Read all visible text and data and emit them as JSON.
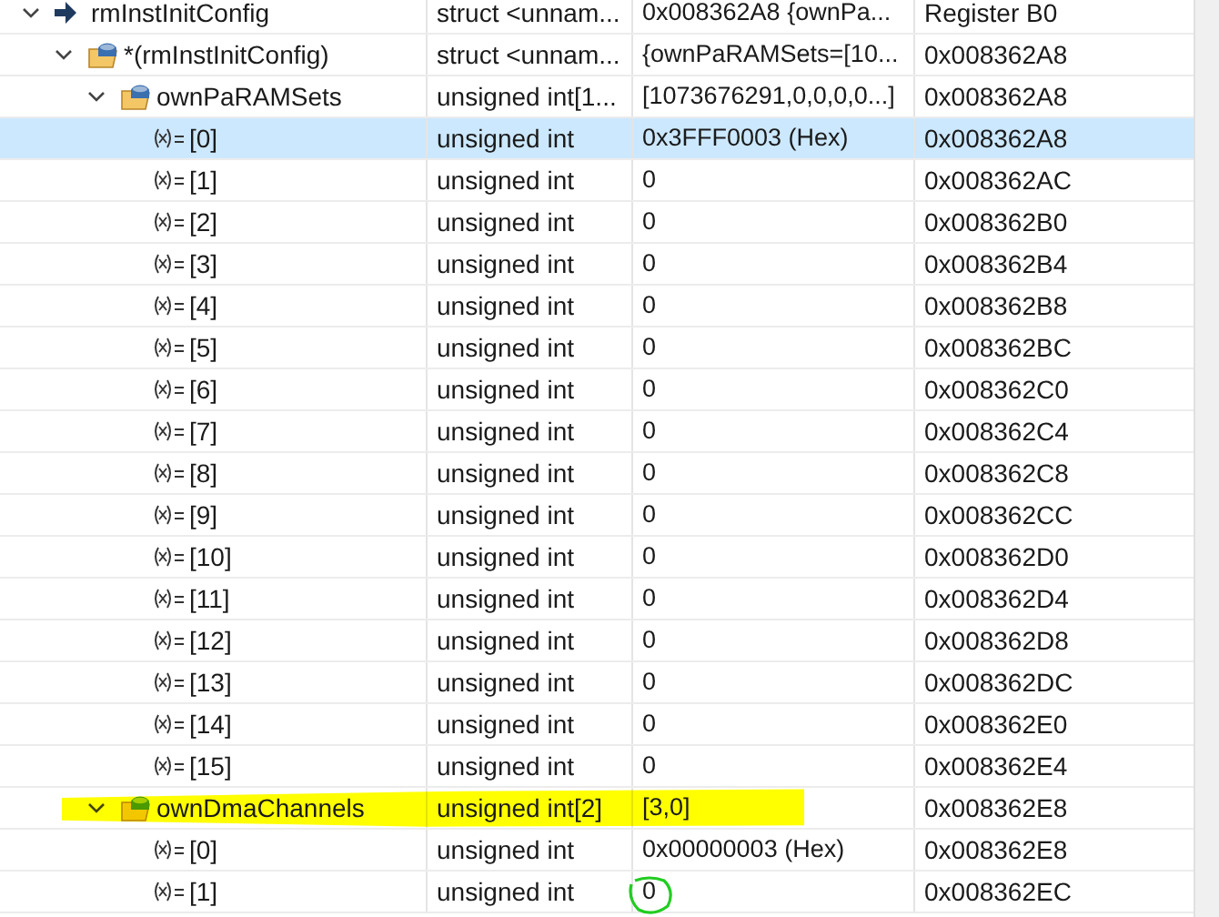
{
  "rows": [
    {
      "kind": "pointer",
      "name": "rmInstInitConfig",
      "type": "struct <unnam...",
      "value": "0x008362A8 {ownPa...",
      "location": "Register B0",
      "expanded": true,
      "selected": false,
      "marked": false,
      "circled": false,
      "children": [
        {
          "kind": "struct",
          "name": "*(rmInstInitConfig)",
          "type": "struct <unnam...",
          "value": "{ownPaRAMSets=[10...",
          "location": "0x008362A8",
          "expanded": true,
          "selected": false,
          "marked": false,
          "circled": false,
          "children": [
            {
              "kind": "array",
              "name": "ownPaRAMSets",
              "type": "unsigned int[1...",
              "value": "[1073676291,0,0,0,0...]",
              "location": "0x008362A8",
              "expanded": true,
              "selected": false,
              "marked": false,
              "circled": false,
              "children": [
                {
                  "kind": "variable",
                  "name": "[0]",
                  "type": "unsigned int",
                  "value": "0x3FFF0003 (Hex)",
                  "location": "0x008362A8",
                  "selected": true,
                  "marked": false,
                  "circled": false
                },
                {
                  "kind": "variable",
                  "name": "[1]",
                  "type": "unsigned int",
                  "value": "0",
                  "location": "0x008362AC",
                  "selected": false,
                  "marked": false,
                  "circled": false
                },
                {
                  "kind": "variable",
                  "name": "[2]",
                  "type": "unsigned int",
                  "value": "0",
                  "location": "0x008362B0",
                  "selected": false,
                  "marked": false,
                  "circled": false
                },
                {
                  "kind": "variable",
                  "name": "[3]",
                  "type": "unsigned int",
                  "value": "0",
                  "location": "0x008362B4",
                  "selected": false,
                  "marked": false,
                  "circled": false
                },
                {
                  "kind": "variable",
                  "name": "[4]",
                  "type": "unsigned int",
                  "value": "0",
                  "location": "0x008362B8",
                  "selected": false,
                  "marked": false,
                  "circled": false
                },
                {
                  "kind": "variable",
                  "name": "[5]",
                  "type": "unsigned int",
                  "value": "0",
                  "location": "0x008362BC",
                  "selected": false,
                  "marked": false,
                  "circled": false
                },
                {
                  "kind": "variable",
                  "name": "[6]",
                  "type": "unsigned int",
                  "value": "0",
                  "location": "0x008362C0",
                  "selected": false,
                  "marked": false,
                  "circled": false
                },
                {
                  "kind": "variable",
                  "name": "[7]",
                  "type": "unsigned int",
                  "value": "0",
                  "location": "0x008362C4",
                  "selected": false,
                  "marked": false,
                  "circled": false
                },
                {
                  "kind": "variable",
                  "name": "[8]",
                  "type": "unsigned int",
                  "value": "0",
                  "location": "0x008362C8",
                  "selected": false,
                  "marked": false,
                  "circled": false
                },
                {
                  "kind": "variable",
                  "name": "[9]",
                  "type": "unsigned int",
                  "value": "0",
                  "location": "0x008362CC",
                  "selected": false,
                  "marked": false,
                  "circled": false
                },
                {
                  "kind": "variable",
                  "name": "[10]",
                  "type": "unsigned int",
                  "value": "0",
                  "location": "0x008362D0",
                  "selected": false,
                  "marked": false,
                  "circled": false
                },
                {
                  "kind": "variable",
                  "name": "[11]",
                  "type": "unsigned int",
                  "value": "0",
                  "location": "0x008362D4",
                  "selected": false,
                  "marked": false,
                  "circled": false
                },
                {
                  "kind": "variable",
                  "name": "[12]",
                  "type": "unsigned int",
                  "value": "0",
                  "location": "0x008362D8",
                  "selected": false,
                  "marked": false,
                  "circled": false
                },
                {
                  "kind": "variable",
                  "name": "[13]",
                  "type": "unsigned int",
                  "value": "0",
                  "location": "0x008362DC",
                  "selected": false,
                  "marked": false,
                  "circled": false
                },
                {
                  "kind": "variable",
                  "name": "[14]",
                  "type": "unsigned int",
                  "value": "0",
                  "location": "0x008362E0",
                  "selected": false,
                  "marked": false,
                  "circled": false
                },
                {
                  "kind": "variable",
                  "name": "[15]",
                  "type": "unsigned int",
                  "value": "0",
                  "location": "0x008362E4",
                  "selected": false,
                  "marked": false,
                  "circled": false
                }
              ]
            },
            {
              "kind": "array-green",
              "name": "ownDmaChannels",
              "type": "unsigned int[2]",
              "value": "[3,0]",
              "location": "0x008362E8",
              "expanded": true,
              "selected": false,
              "marked": true,
              "circled": false,
              "children": [
                {
                  "kind": "variable",
                  "name": "[0]",
                  "type": "unsigned int",
                  "value": "0x00000003 (Hex)",
                  "location": "0x008362E8",
                  "selected": false,
                  "marked": false,
                  "circled": false
                },
                {
                  "kind": "variable",
                  "name": "[1]",
                  "type": "unsigned int",
                  "value": "0",
                  "location": "0x008362EC",
                  "selected": false,
                  "marked": false,
                  "circled": true
                }
              ]
            }
          ]
        }
      ]
    }
  ]
}
